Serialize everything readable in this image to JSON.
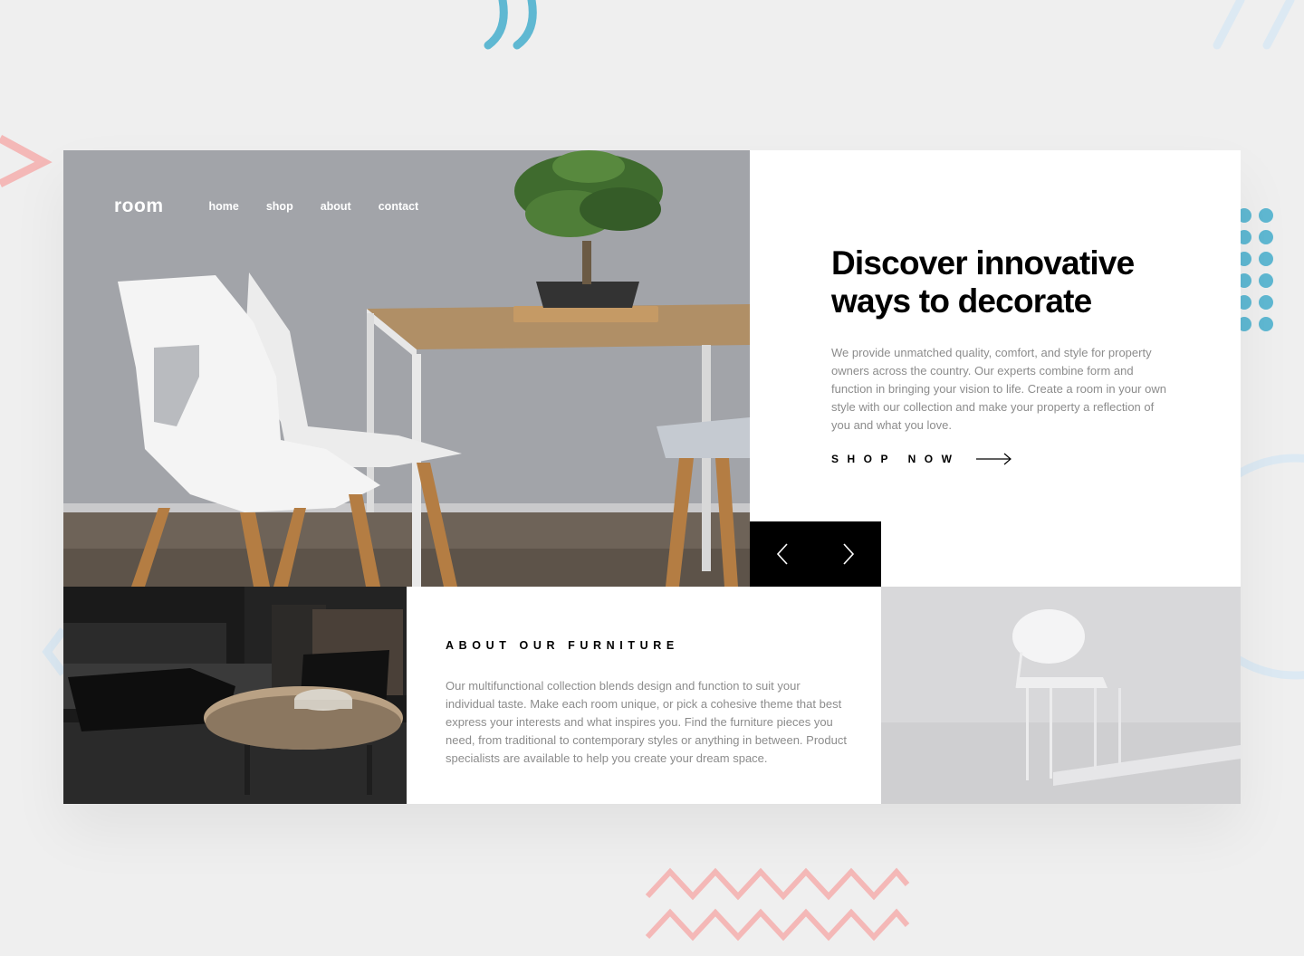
{
  "colors": {
    "background": "#efefef",
    "accent_teal": "#5fb8d2",
    "accent_pink": "#f4b8b7",
    "accent_lightblue": "#dce9f3",
    "text_dark": "#000000",
    "text_muted": "#8c8c8c"
  },
  "header": {
    "logo": "room",
    "nav": [
      "home",
      "shop",
      "about",
      "contact"
    ]
  },
  "hero": {
    "title_line1": "Discover innovative",
    "title_line2": "ways to decorate",
    "description": "We provide unmatched quality, comfort, and style for property owners across the country. Our experts combine form and function in bringing your vision to life. Create a room in your own style with our collection and make your property a reflection of you and what you love.",
    "cta": "SHOP NOW",
    "cta_icon": "arrow-right-icon",
    "image": "white-chairs-bonsai-table-photo"
  },
  "slider": {
    "prev_icon": "chevron-left-icon",
    "next_icon": "chevron-right-icon"
  },
  "about": {
    "title": "ABOUT OUR FURNITURE",
    "text": "Our multifunctional collection blends design and function to suit your individual taste. Make each room unique, or pick a cohesive theme that best express your interests and what inspires you. Find the furniture pieces you need, from traditional to contemporary styles or anything in between. Product specialists are available to help you create your dream space.",
    "image_left": "dark-armchair-room-photo",
    "image_right": "white-chair-photo"
  }
}
